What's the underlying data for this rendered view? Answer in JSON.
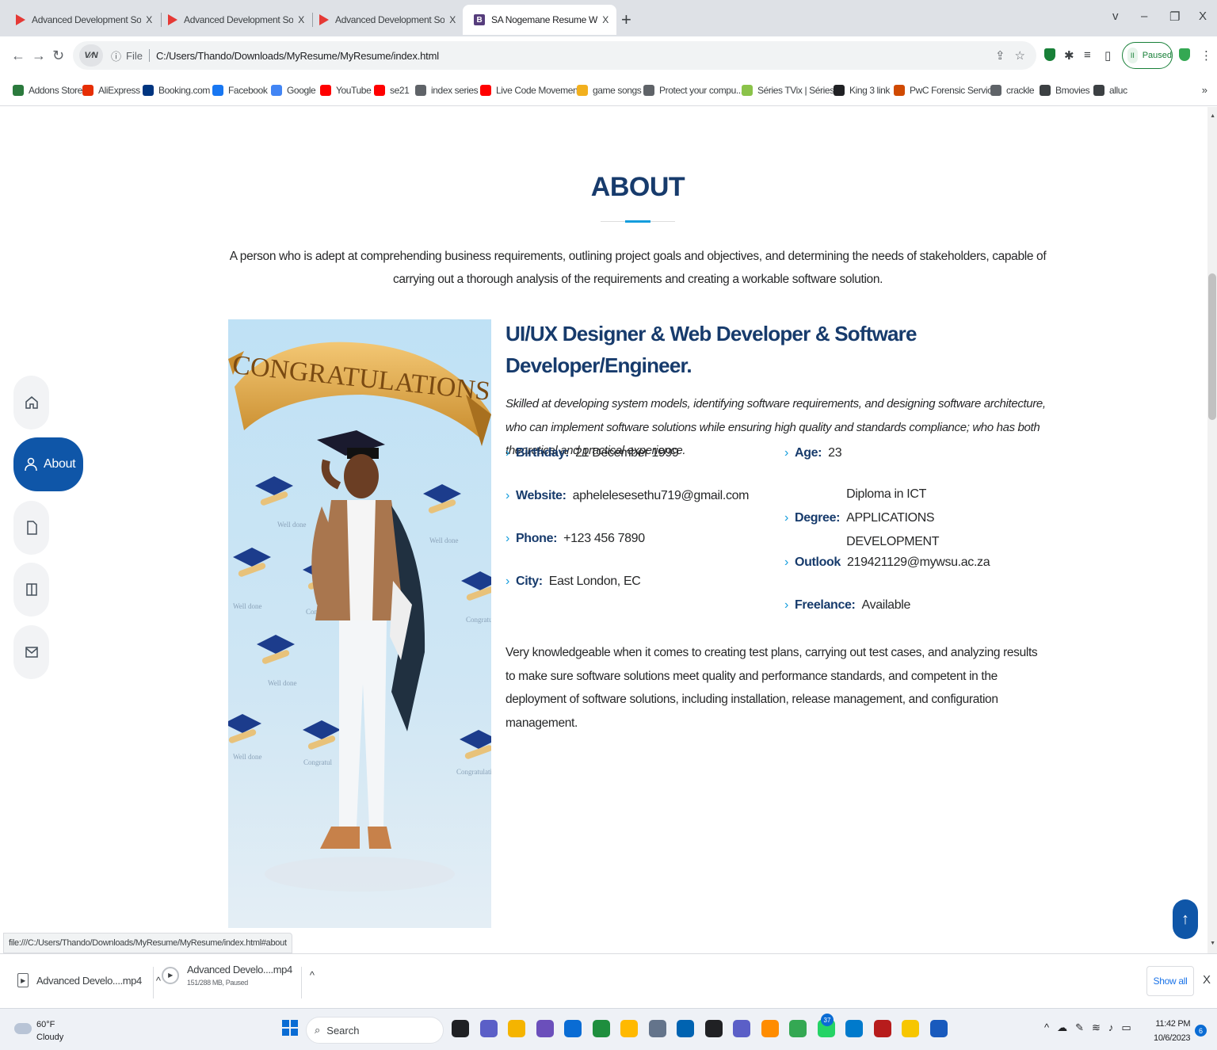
{
  "browser": {
    "tabs": [
      {
        "title": "Advanced Development Softwar",
        "favicon": "youtube-icon",
        "active": false
      },
      {
        "title": "Advanced Development Softwar",
        "favicon": "youtube-icon",
        "active": false
      },
      {
        "title": "Advanced Development Softwar",
        "favicon": "youtube-icon",
        "active": false
      },
      {
        "title": "SA Nogemane Resume Website",
        "favicon": "bootstrap-icon",
        "active": true
      }
    ],
    "tab_close": "X",
    "new_tab": "+",
    "window_controls": {
      "chevron": "v",
      "minimize": "–",
      "restore": "❐",
      "close": "X"
    },
    "address": {
      "vpn_badge": "V⁄N",
      "scheme": "File",
      "url": "C:/Users/Thando/Downloads/MyResume/MyResume/index.html"
    },
    "paused_label": "Paused",
    "bookmarks": [
      {
        "label": "Addons Store",
        "color": "#2b7a3d"
      },
      {
        "label": "AliExpress",
        "color": "#e62e04"
      },
      {
        "label": "Booking.com",
        "color": "#003580"
      },
      {
        "label": "Facebook",
        "color": "#1877f2"
      },
      {
        "label": "Google",
        "color": "#4285f4"
      },
      {
        "label": "YouTube",
        "color": "#ff0000"
      },
      {
        "label": "se21",
        "color": "#ff0000"
      },
      {
        "label": "index series",
        "color": "#5f6368"
      },
      {
        "label": "Live Code Movement",
        "color": "#ff0000"
      },
      {
        "label": "game songs",
        "color": "#f2b01e"
      },
      {
        "label": "Protect your compu...",
        "color": "#5f6368"
      },
      {
        "label": "Séries TVix | Séries...",
        "color": "#8bc34a"
      },
      {
        "label": "King 3 link",
        "color": "#202124"
      },
      {
        "label": "PwC Forensic Servic...",
        "color": "#d04a02"
      },
      {
        "label": "crackle",
        "color": "#5f6368"
      },
      {
        "label": "Bmovies",
        "color": "#3c4043"
      },
      {
        "label": "alluc",
        "color": "#3c4043"
      }
    ],
    "bookmarks_more": "»",
    "status_url": "file:///C:/Users/Thando/Downloads/MyResume/MyResume/index.html#about"
  },
  "sidenav": {
    "items": [
      {
        "name": "home",
        "icon": "home-icon",
        "label": ""
      },
      {
        "name": "about",
        "icon": "person-icon",
        "label": "About"
      },
      {
        "name": "resume",
        "icon": "file-icon",
        "label": ""
      },
      {
        "name": "portfolio",
        "icon": "book-icon",
        "label": ""
      },
      {
        "name": "contact",
        "icon": "envelope-icon",
        "label": ""
      }
    ]
  },
  "about": {
    "title": "ABOUT",
    "intro": "A person who is adept at comprehending business requirements, outlining project goals and objectives, and determining the needs of stakeholders, capable of carrying out a thorough analysis of the requirements and creating a workable software solution.",
    "photo_banner": "CONGRATULATIONS",
    "photo_tiles": [
      "Well done",
      "Well done",
      "Well done",
      "Congratu",
      "Congratul",
      "Well done",
      "Congratul",
      "Well done",
      "Congratulation"
    ],
    "role": "UI/UX Designer & Web Developer & Software Developer/Engineer.",
    "summary": "Skilled at developing system models, identifying software requirements, and designing software architecture, who can implement software solutions while ensuring high quality and standards compliance; who has both theoretical and practical experience.",
    "left_info": [
      {
        "label": "Birthday:",
        "value": "21 December 1999"
      },
      {
        "label": "Website:",
        "value": "aphelelesesethu719@gmail.com"
      },
      {
        "label": "Phone:",
        "value": "+123 456 7890"
      },
      {
        "label": "City:",
        "value": "East London, EC"
      }
    ],
    "right_info": [
      {
        "label": "Age:",
        "value": "23"
      },
      {
        "label": "Degree:",
        "value": "Diploma in ICT APPLICATIONS DEVELOPMENT"
      },
      {
        "label": "Outlook",
        "value": "219421129@mywsu.ac.za"
      },
      {
        "label": "Freelance:",
        "value": "Available"
      }
    ],
    "closing": "Very knowledgeable when it comes to creating test plans, carrying out test cases, and analyzing results to make sure software solutions meet quality and performance standards, and competent in the deployment of software solutions, including installation, release management, and configuration management."
  },
  "downloads": {
    "items": [
      {
        "name": "Advanced Develo....mp4",
        "sub": ""
      },
      {
        "name": "Advanced Develo....mp4",
        "sub": "151/288 MB, Paused"
      }
    ],
    "show_all": "Show all",
    "close": "X"
  },
  "taskbar": {
    "weather_temp": "60°F",
    "weather_desc": "Cloudy",
    "search_label": "Search",
    "badge_count": "37",
    "time": "11:42 PM",
    "date": "10/6/2023",
    "notification_count": "6",
    "app_colors": [
      "#202124",
      "#5b5fc7",
      "#f5b400",
      "#6b4fbb",
      "#0a6cd4",
      "#1e8e3e",
      "#ffb900",
      "#64748b",
      "#0063b1",
      "#202124",
      "#5b5fc7",
      "#ff8c00",
      "#34a853",
      "#25d366",
      "#007acc",
      "#b71c1c",
      "#f7c600",
      "#185abd"
    ]
  },
  "colors": {
    "accent": "#149ddd",
    "heading": "#173b6c",
    "nav_active": "#0f56a8"
  }
}
